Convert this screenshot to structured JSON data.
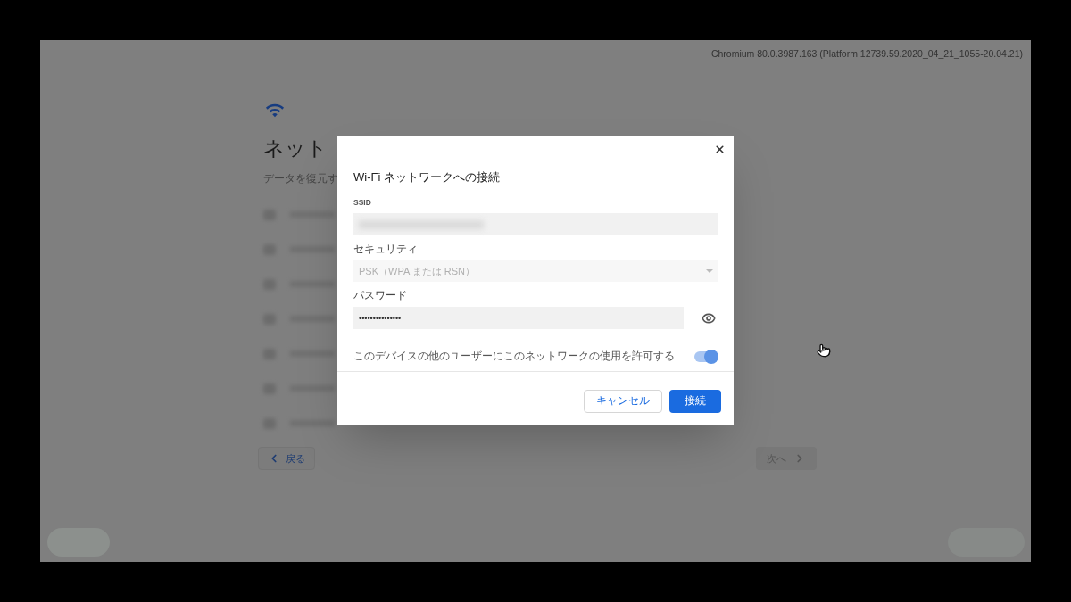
{
  "version": "Chromium 80.0.3987.163 (Platform 12739.59.2020_04_21_1055-20.04.21)",
  "page": {
    "title": "ネット",
    "subtitle": "データを復元す",
    "back_button": "戻る",
    "next_button": "次へ",
    "next_disabled": true
  },
  "dialog": {
    "title": "Wi-Fi ネットワークへの接続",
    "ssid": {
      "label": "SSID"
    },
    "security": {
      "label": "セキュリティ",
      "value": "PSK（WPA または RSN）",
      "disabled": true
    },
    "password": {
      "label": "パスワード",
      "value": "•••••••••••••••"
    },
    "share": {
      "label": "このデバイスの他のユーザーにこのネットワークの使用を許可する",
      "on": true
    },
    "buttons": [
      {
        "label": "キャンセル",
        "kind": "secondary"
      },
      {
        "label": "接続",
        "kind": "primary"
      }
    ]
  }
}
